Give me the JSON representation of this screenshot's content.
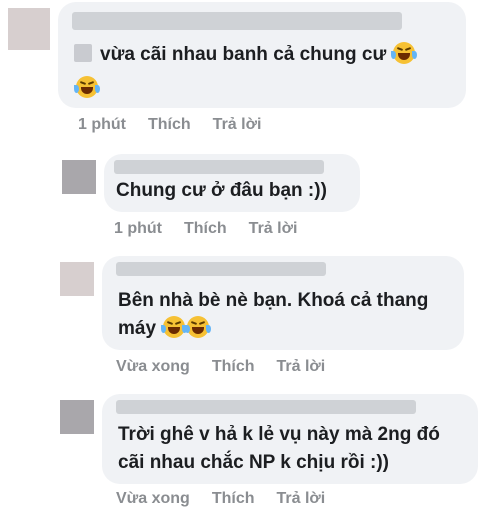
{
  "comments": [
    {
      "line1": "vừa cãi nhau banh cả chung cư",
      "line2": "",
      "time": "1 phút",
      "like": "Thích",
      "reply": "Trả lời"
    },
    {
      "line1": "Chung cư ở đâu bạn :))",
      "time": "1 phút",
      "like": "Thích",
      "reply": "Trả lời"
    },
    {
      "line1": "Bên nhà bè nè bạn. Khoá cả thang",
      "line2": "máy",
      "time": "Vừa xong",
      "like": "Thích",
      "reply": "Trả lời"
    },
    {
      "line1": "Trời ghê v hả k lẻ vụ này mà 2ng đó",
      "line2": "cãi nhau chắc NP k chịu rồi :))",
      "time": "Vừa xong",
      "like": "Thích",
      "reply": "Trả lời"
    }
  ],
  "icons": {
    "emoji": "laughing-tears-emoji"
  }
}
